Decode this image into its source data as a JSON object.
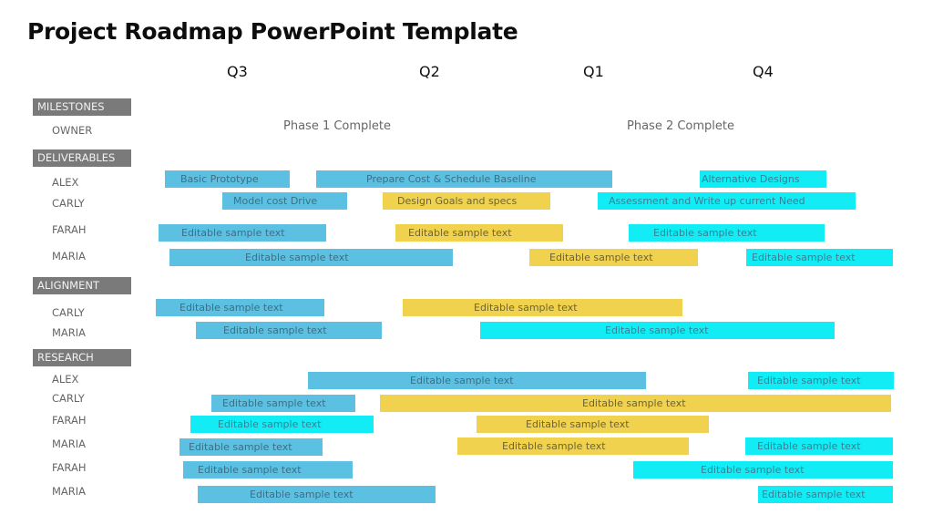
{
  "title": "Project Roadmap PowerPoint Template",
  "quarters": [
    "Q3",
    "Q2",
    "Q1",
    "Q4"
  ],
  "phases": [
    "Phase 1 Complete",
    "Phase 2 Complete"
  ],
  "colors": {
    "blue": "#5bc0e1",
    "yellow": "#f0d24f",
    "cyan": "#12ecf5",
    "section_header": "#7a7a7a"
  },
  "sections": [
    {
      "label": "MILESTONES",
      "owners": [
        "OWNER"
      ]
    },
    {
      "label": "DELIVERABLES",
      "owners": [
        "ALEX",
        "CARLY",
        "FARAH",
        "MARIA"
      ]
    },
    {
      "label": "ALIGNMENT",
      "owners": [
        "CARLY",
        "MARIA"
      ]
    },
    {
      "label": "RESEARCH",
      "owners": [
        "ALEX",
        "CARLY",
        "FARAH",
        "MARIA",
        "FARAH",
        "MARIA"
      ]
    }
  ],
  "bars": [
    {
      "text": "Basic Prototype",
      "color": "blue"
    },
    {
      "text": "Prepare  Cost & Schedule  Baseline",
      "color": "blue"
    },
    {
      "text": "Alternative Designs",
      "color": "cyan"
    },
    {
      "text": "Model  cost Drive",
      "color": "blue"
    },
    {
      "text": "Design Goals and specs",
      "color": "yellow"
    },
    {
      "text": "Assessment and Write up  current  Need",
      "color": "cyan"
    },
    {
      "text": "Editable sample text",
      "color": "blue"
    },
    {
      "text": "Editable sample text",
      "color": "yellow"
    },
    {
      "text": "Editable sample text",
      "color": "cyan"
    },
    {
      "text": "Editable sample text",
      "color": "blue"
    },
    {
      "text": "Editable sample text",
      "color": "yellow"
    },
    {
      "text": "Editable sample text",
      "color": "cyan"
    },
    {
      "text": "Editable sample text",
      "color": "blue"
    },
    {
      "text": "Editable sample text",
      "color": "yellow"
    },
    {
      "text": "Editable sample text",
      "color": "blue"
    },
    {
      "text": "Editable sample text",
      "color": "cyan"
    },
    {
      "text": "Editable sample text",
      "color": "blue"
    },
    {
      "text": "Editable sample text",
      "color": "cyan"
    },
    {
      "text": "Editable sample text",
      "color": "blue"
    },
    {
      "text": "Editable sample text",
      "color": "yellow"
    },
    {
      "text": "Editable sample text",
      "color": "cyan"
    },
    {
      "text": "Editable sample text",
      "color": "yellow"
    },
    {
      "text": "Editable sample text",
      "color": "blue"
    },
    {
      "text": "Editable sample text",
      "color": "yellow"
    },
    {
      "text": "Editable sample text",
      "color": "cyan"
    },
    {
      "text": "Editable sample text",
      "color": "blue"
    },
    {
      "text": "Editable sample text",
      "color": "cyan"
    },
    {
      "text": "Editable sample text",
      "color": "blue"
    },
    {
      "text": "Editable sample text",
      "color": "cyan"
    }
  ]
}
